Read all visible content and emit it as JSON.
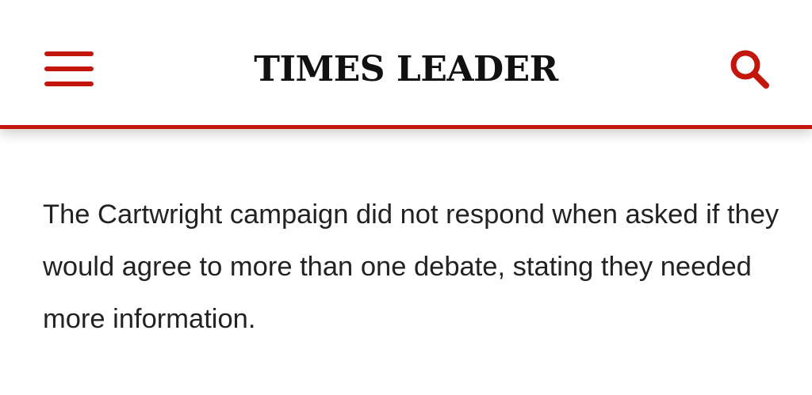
{
  "header": {
    "menu_icon": "hamburger-menu-icon",
    "logo_text": "TIMES LEADER",
    "search_icon": "search-icon",
    "accent_color": "#c4170c"
  },
  "article": {
    "paragraph": "The Cartwright campaign did not respond when asked if they would agree to more than one debate, stating they needed more information."
  }
}
